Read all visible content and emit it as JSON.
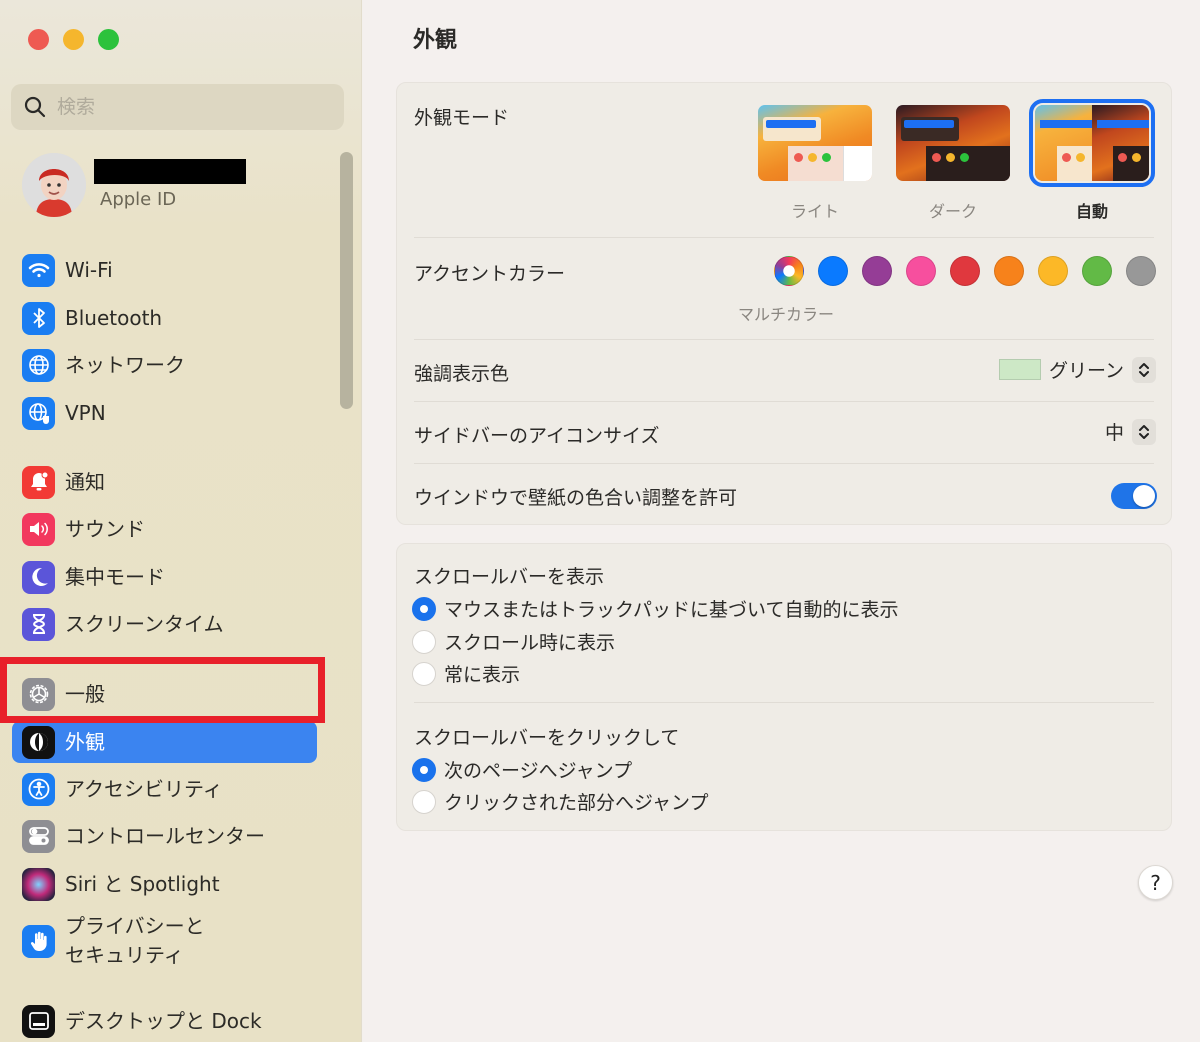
{
  "window": {
    "controls": [
      "close",
      "minimize",
      "zoom"
    ]
  },
  "sidebar": {
    "search_placeholder": "検索",
    "account": {
      "name_redacted": true,
      "subtitle": "Apple ID"
    },
    "items": [
      {
        "label": "Wi-Fi",
        "icon": "wifi-icon",
        "color": "#1a7df2"
      },
      {
        "label": "Bluetooth",
        "icon": "bluetooth-icon",
        "color": "#1a7df2"
      },
      {
        "label": "ネットワーク",
        "icon": "globe-icon",
        "color": "#1a7df2"
      },
      {
        "label": "VPN",
        "icon": "vpn-globe-icon",
        "color": "#1a7df2"
      },
      {
        "label": "通知",
        "icon": "bell-icon",
        "color": "#f23a35"
      },
      {
        "label": "サウンド",
        "icon": "speaker-icon",
        "color": "#f2385e"
      },
      {
        "label": "集中モード",
        "icon": "moon-icon",
        "color": "#5b55d9"
      },
      {
        "label": "スクリーンタイム",
        "icon": "hourglass-icon",
        "color": "#5b55d9"
      },
      {
        "label": "一般",
        "icon": "gear-icon",
        "color": "#8e8e93"
      },
      {
        "label": "外観",
        "icon": "appearance-icon",
        "color": "#111111",
        "selected": true
      },
      {
        "label": "アクセシビリティ",
        "icon": "accessibility-icon",
        "color": "#1a7df2"
      },
      {
        "label": "コントロールセンター",
        "icon": "toggles-icon",
        "color": "#8e8e93"
      },
      {
        "label": "Siri と Spotlight",
        "icon": "siri-icon",
        "color": "#3a2a5e"
      },
      {
        "label": "プライバシーと\nセキュリティ",
        "icon": "hand-icon",
        "color": "#1a7df2"
      },
      {
        "label": "デスクトップと Dock",
        "icon": "dock-icon",
        "color": "#111111"
      }
    ],
    "highlighted_item": "一般"
  },
  "main": {
    "title": "外観",
    "appearance_mode": {
      "label": "外観モード",
      "options": [
        {
          "label": "ライト",
          "selected": false
        },
        {
          "label": "ダーク",
          "selected": false
        },
        {
          "label": "自動",
          "selected": true
        }
      ]
    },
    "accent_color": {
      "label": "アクセントカラー",
      "selected_caption": "マルチカラー",
      "swatches": [
        {
          "name": "multicolor",
          "color": "multicolor",
          "selected": true
        },
        {
          "name": "blue",
          "color": "#0a7aff"
        },
        {
          "name": "purple",
          "color": "#953d96"
        },
        {
          "name": "pink",
          "color": "#f74f9e"
        },
        {
          "name": "red",
          "color": "#e0383e"
        },
        {
          "name": "orange",
          "color": "#f7821b"
        },
        {
          "name": "yellow",
          "color": "#fcb827"
        },
        {
          "name": "green",
          "color": "#62ba46"
        },
        {
          "name": "graphite",
          "color": "#989898"
        }
      ]
    },
    "highlight_color": {
      "label": "強調表示色",
      "value": "グリーン",
      "chip_color": "#cde8c6"
    },
    "sidebar_icon_size": {
      "label": "サイドバーのアイコンサイズ",
      "value": "中"
    },
    "wallpaper_tinting": {
      "label": "ウインドウで壁紙の色合い調整を許可",
      "enabled": true
    },
    "show_scrollbars": {
      "title": "スクロールバーを表示",
      "options": [
        {
          "label": "マウスまたはトラックパッドに基づいて自動的に表示",
          "checked": true
        },
        {
          "label": "スクロール時に表示",
          "checked": false
        },
        {
          "label": "常に表示",
          "checked": false
        }
      ]
    },
    "click_scrollbar": {
      "title": "スクロールバーをクリックして",
      "options": [
        {
          "label": "次のページへジャンプ",
          "checked": true
        },
        {
          "label": "クリックされた部分へジャンプ",
          "checked": false
        }
      ]
    },
    "help_label": "?"
  }
}
